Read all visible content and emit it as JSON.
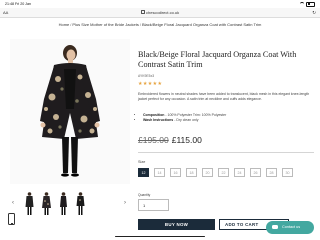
{
  "status_bar": {
    "time": "21:48",
    "date": "Fri 20 Jan",
    "battery": ""
  },
  "browser": {
    "reader_label": "AA",
    "url": "chescodirect.co.uk"
  },
  "breadcrumb": [
    "Home",
    "Plus Size Mother of the Bride Jackets",
    "Black/Beige Floral Jacquard Organza Coat with Contrast Satin Trim"
  ],
  "product": {
    "title": "Black/Beige Floral Jacquard Organza Coat With Contrast Satin Trim",
    "sku": "AYK9E5x3",
    "rating_stars": "★★★★★",
    "rating_value": 5,
    "description": "Embroidered flowers in neutral shades have been added to translucent, black mesh in this elegant knee-length jacket perfect for any occasion. A satin trim at neckline and cuffs adds elegance.",
    "specs": [
      {
        "label": "Composition",
        "value": " - 100% Polyester Trim: 100% Polyester"
      },
      {
        "label": "Wash Instructions",
        "value": " - Dry clean only"
      }
    ],
    "old_price": "£195.00",
    "price": "£115.00",
    "size_label": "Size",
    "sizes": [
      "12",
      "14",
      "16",
      "18",
      "20",
      "22",
      "24",
      "26",
      "28",
      "30"
    ],
    "selected_size": "12",
    "quantity_label": "Quantity",
    "quantity": "1",
    "buy_now_label": "BUY NOW",
    "add_to_cart_label": "ADD TO CART"
  },
  "chat": {
    "label": "Contact us"
  },
  "colors": {
    "navy": "#1b2b3a",
    "teal": "#43a8a0",
    "stars": "#e7a33e"
  },
  "icons": [
    "lock-icon",
    "reload-icon",
    "chevron-left-icon",
    "chevron-right-icon",
    "phone-icon",
    "chat-icon"
  ]
}
